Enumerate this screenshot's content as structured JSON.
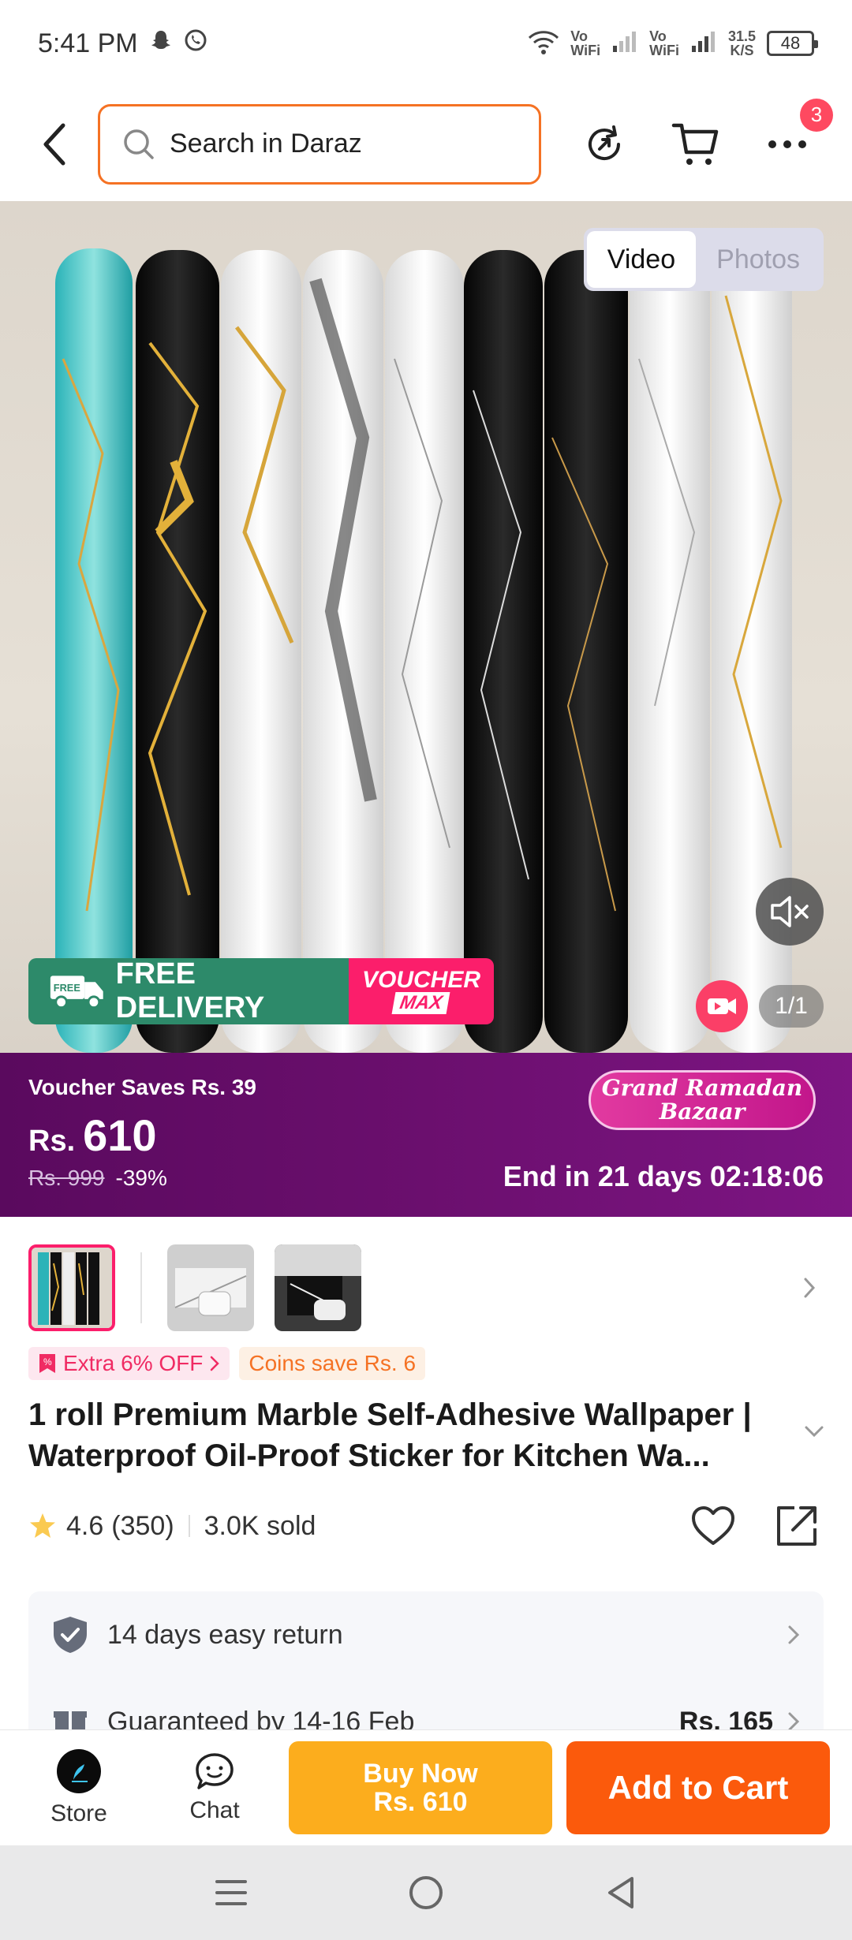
{
  "status_bar": {
    "time": "5:41 PM",
    "net1_top": "Vo",
    "net1_bottom": "WiFi",
    "net2_top": "Vo",
    "net2_bottom": "WiFi",
    "speed_value": "31.5",
    "speed_unit": "K/S",
    "battery": "48"
  },
  "header": {
    "search_placeholder": "Search in Daraz",
    "cart_badge": "3"
  },
  "hero": {
    "toggle_video": "Video",
    "toggle_photos": "Photos",
    "free_delivery_tag": "FREE",
    "free_delivery": "FREE DELIVERY",
    "voucher_line1": "VOUCHER",
    "voucher_line2": "MAX",
    "counter": "1/1"
  },
  "price_banner": {
    "voucher_saves": "Voucher Saves Rs. 39",
    "currency": "Rs.",
    "price": "610",
    "original_price": "Rs. 999",
    "discount": "-39%",
    "campaign_line1": "Grand Ramadan",
    "campaign_line2": "Bazaar",
    "ends": "End in 21 days 02:18:06"
  },
  "tags": {
    "extra_off": "Extra 6% OFF",
    "coins": "Coins save Rs. 6"
  },
  "product": {
    "title": "1 roll Premium Marble Self-Adhesive Wallpaper | Waterproof Oil-Proof Sticker for Kitchen Wa...",
    "rating": "4.6",
    "reviews": "(350)",
    "sold": "3.0K sold"
  },
  "service": {
    "return": "14 days easy return",
    "delivery": "Guaranteed by 14-16 Feb",
    "delivery_fee": "Rs. 165"
  },
  "action_bar": {
    "store": "Store",
    "chat": "Chat",
    "buy_now_line1": "Buy Now",
    "buy_now_line2": "Rs. 610",
    "add_to_cart": "Add to Cart"
  },
  "colors": {
    "brand_orange": "#f57224",
    "buy_now": "#fcad1d",
    "add_to_cart": "#fb5a0c",
    "campaign_purple": "#6b0f6e"
  },
  "icons": [
    "back-icon",
    "search-icon",
    "share-refresh-icon",
    "cart-icon",
    "more-icon",
    "mute-icon",
    "video-icon",
    "chevron-right-icon",
    "chevron-down-icon",
    "star-icon",
    "heart-icon",
    "share-icon",
    "shield-icon",
    "gift-icon",
    "store-icon",
    "chat-icon",
    "menu-nav-icon",
    "home-nav-icon",
    "back-nav-icon"
  ]
}
